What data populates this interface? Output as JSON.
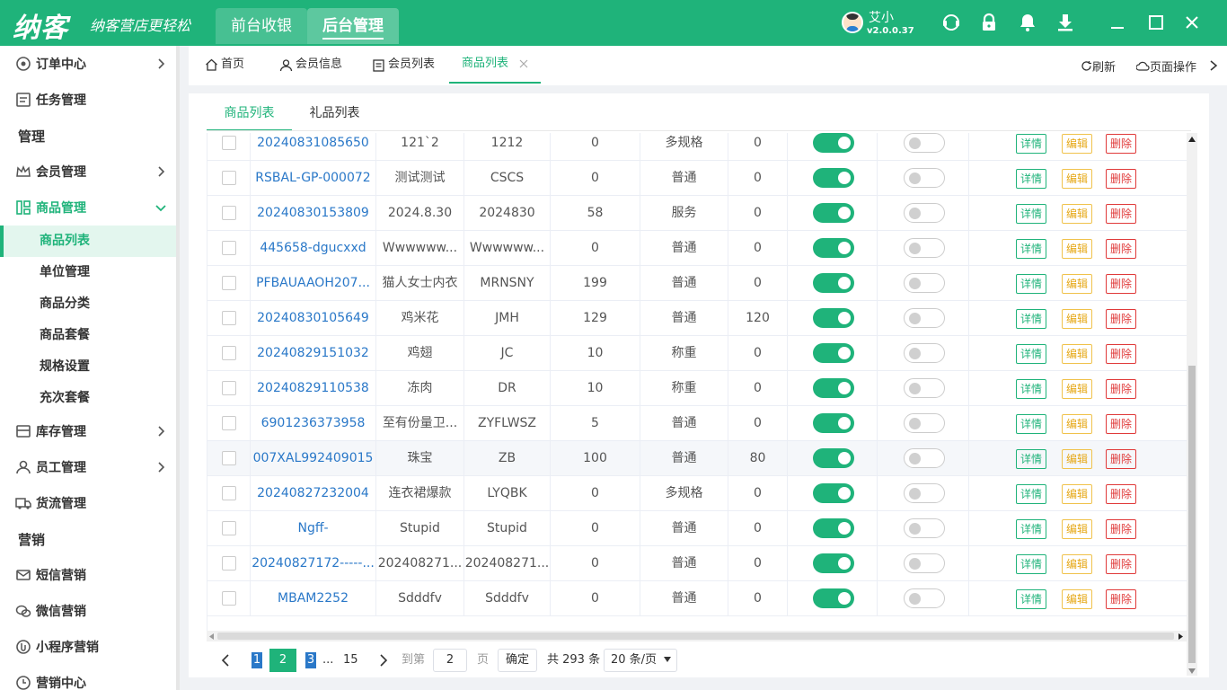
{
  "header": {
    "logo": "纳客",
    "slogan": "纳客营店更轻松",
    "tabs": [
      {
        "label": "前台收银"
      },
      {
        "label": "后台管理"
      }
    ],
    "user": {
      "name": "艾小",
      "version": "v2.0.0.37"
    }
  },
  "sidebar": {
    "items": [
      {
        "label": "订单中心"
      },
      {
        "label": "任务管理"
      },
      {
        "label": "管理"
      },
      {
        "label": "会员管理"
      },
      {
        "label": "商品管理"
      },
      {
        "label": "库存管理"
      },
      {
        "label": "员工管理"
      },
      {
        "label": "货流管理"
      },
      {
        "label": "营销"
      },
      {
        "label": "短信营销"
      },
      {
        "label": "微信营销"
      },
      {
        "label": "小程序营销"
      },
      {
        "label": "营销中心"
      }
    ],
    "subitems": [
      {
        "label": "商品列表"
      },
      {
        "label": "单位管理"
      },
      {
        "label": "商品分类"
      },
      {
        "label": "商品套餐"
      },
      {
        "label": "规格设置"
      },
      {
        "label": "充次套餐"
      }
    ]
  },
  "pagetabs": [
    {
      "label": "首页"
    },
    {
      "label": "会员信息"
    },
    {
      "label": "会员列表"
    },
    {
      "label": "商品列表"
    }
  ],
  "actions": {
    "refresh": "刷新",
    "page_ops": "页面操作"
  },
  "subtabs": [
    {
      "label": "商品列表"
    },
    {
      "label": "礼品列表"
    }
  ],
  "buttons": {
    "detail": "详情",
    "edit": "编辑",
    "delete": "删除"
  },
  "rows": [
    {
      "code": "20240831085650",
      "name": "121`2",
      "abbr": "1212",
      "c4": "0",
      "type": "多规格",
      "c6": "0"
    },
    {
      "code": "RSBAL-GP-000072",
      "name": "测试测试",
      "abbr": "CSCS",
      "c4": "0",
      "type": "普通",
      "c6": "0"
    },
    {
      "code": "20240830153809",
      "name": "2024.8.30",
      "abbr": "2024830",
      "c4": "58",
      "type": "服务",
      "c6": "0"
    },
    {
      "code": "445658-dgucxxd",
      "name": "Wwwwww...",
      "abbr": "Wwwwww...",
      "c4": "0",
      "type": "普通",
      "c6": "0"
    },
    {
      "code": "PFBAUAAOH207...",
      "name": "猫人女士内衣",
      "abbr": "MRNSNY",
      "c4": "199",
      "type": "普通",
      "c6": "0"
    },
    {
      "code": "20240830105649",
      "name": "鸡米花",
      "abbr": "JMH",
      "c4": "129",
      "type": "普通",
      "c6": "120"
    },
    {
      "code": "20240829151032",
      "name": "鸡翅",
      "abbr": "JC",
      "c4": "10",
      "type": "称重",
      "c6": "0"
    },
    {
      "code": "20240829110538",
      "name": "冻肉",
      "abbr": "DR",
      "c4": "10",
      "type": "称重",
      "c6": "0"
    },
    {
      "code": "6901236373958",
      "name": "至有份量卫...",
      "abbr": "ZYFLWSZ",
      "c4": "5",
      "type": "普通",
      "c6": "0"
    },
    {
      "code": "007XAL992409015",
      "name": "珠宝",
      "abbr": "ZB",
      "c4": "100",
      "type": "普通",
      "c6": "80"
    },
    {
      "code": "20240827232004",
      "name": "连衣裙爆款",
      "abbr": "LYQBK",
      "c4": "0",
      "type": "多规格",
      "c6": "0"
    },
    {
      "code": "Ngff-",
      "name": "Stupid",
      "abbr": "Stupid",
      "c4": "0",
      "type": "普通",
      "c6": "0"
    },
    {
      "code": "20240827172-----...",
      "name": "202408271...",
      "abbr": "202408271...",
      "c4": "0",
      "type": "普通",
      "c6": "0"
    },
    {
      "code": "MBAM2252",
      "name": "Sdddfv",
      "abbr": "Sdddfv",
      "c4": "0",
      "type": "普通",
      "c6": "0"
    }
  ],
  "pagination": {
    "pages": [
      "1",
      "2",
      "3"
    ],
    "current": "2",
    "ellipsis": "...",
    "last": "15",
    "goto_label": "到第",
    "goto_value": "2",
    "page_unit": "页",
    "confirm": "确定",
    "total": "共 293 条",
    "page_size": "20 条/页"
  },
  "colors": {
    "primary": "#1fb37a",
    "link": "#2a78c8",
    "edit": "#e6a817",
    "delete": "#e03a3a"
  }
}
